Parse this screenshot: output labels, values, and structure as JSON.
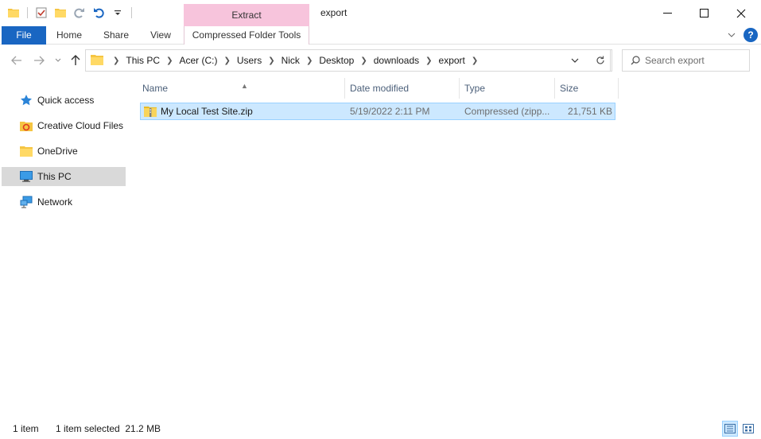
{
  "window": {
    "title": "export",
    "context_tab_header": "Extract"
  },
  "ribbon": {
    "tabs": [
      {
        "label": "File"
      },
      {
        "label": "Home"
      },
      {
        "label": "Share"
      },
      {
        "label": "View"
      },
      {
        "label": "Compressed Folder Tools"
      }
    ]
  },
  "address": {
    "breadcrumbs": [
      "This PC",
      "Acer (C:)",
      "Users",
      "Nick",
      "Desktop",
      "downloads",
      "export"
    ]
  },
  "search": {
    "placeholder": "Search export"
  },
  "nav": {
    "items": [
      {
        "label": "Quick access",
        "icon": "star-icon"
      },
      {
        "label": "Creative Cloud Files",
        "icon": "creative-cloud-icon"
      },
      {
        "label": "OneDrive",
        "icon": "folder-icon"
      },
      {
        "label": "This PC",
        "icon": "monitor-icon"
      },
      {
        "label": "Network",
        "icon": "network-icon"
      }
    ],
    "selected": "This PC"
  },
  "columns": {
    "name": "Name",
    "date": "Date modified",
    "type": "Type",
    "size": "Size"
  },
  "files": [
    {
      "name": "My Local Test Site.zip",
      "date": "5/19/2022 2:11 PM",
      "type": "Compressed (zipp...",
      "size": "21,751 KB",
      "icon": "zip-folder-icon"
    }
  ],
  "status": {
    "item_count": "1 item",
    "selection": "1 item selected  21.2 MB"
  },
  "colors": {
    "accent": "#1966c2",
    "context_tab": "#f7c4dc",
    "selection_fill": "#cce8ff",
    "selection_border": "#99d1ff"
  }
}
